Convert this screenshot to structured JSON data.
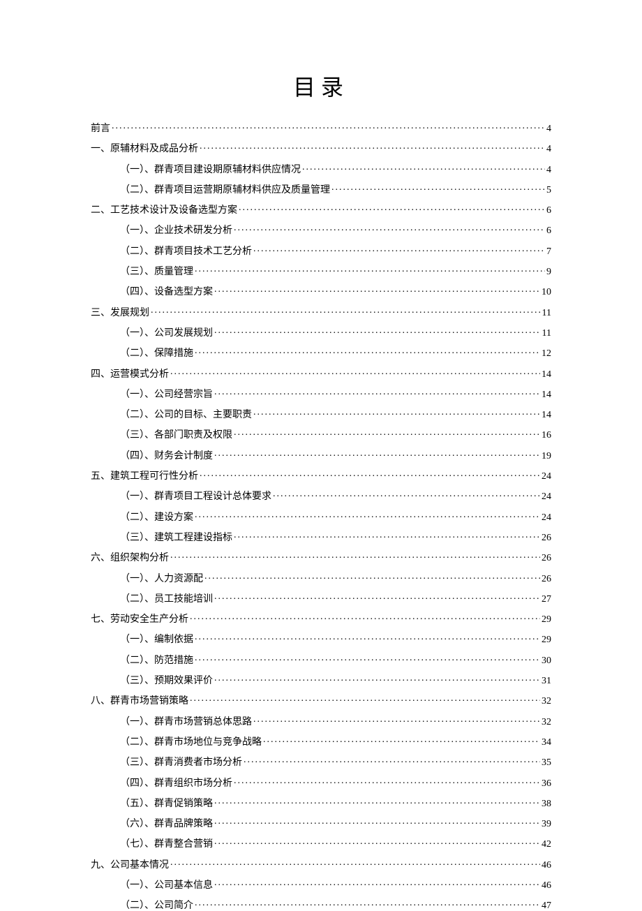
{
  "title": "目录",
  "entries": [
    {
      "level": 1,
      "label": "前言",
      "page": "4"
    },
    {
      "level": 1,
      "label": "一、原辅材料及成品分析",
      "page": "4"
    },
    {
      "level": 2,
      "label": "（一）、群青项目建设期原辅材料供应情况",
      "page": "4"
    },
    {
      "level": 2,
      "label": "（二）、群青项目运营期原辅材料供应及质量管理",
      "page": "5"
    },
    {
      "level": 1,
      "label": "二、工艺技术设计及设备选型方案",
      "page": "6"
    },
    {
      "level": 2,
      "label": "（一）、企业技术研发分析",
      "page": "6"
    },
    {
      "level": 2,
      "label": "（二）、群青项目技术工艺分析",
      "page": "7"
    },
    {
      "level": 2,
      "label": "（三）、质量管理",
      "page": "9"
    },
    {
      "level": 2,
      "label": "（四）、设备选型方案",
      "page": "10"
    },
    {
      "level": 1,
      "label": "三、发展规划",
      "page": "11"
    },
    {
      "level": 2,
      "label": "（一）、公司发展规划",
      "page": "11"
    },
    {
      "level": 2,
      "label": "（二）、保障措施",
      "page": "12"
    },
    {
      "level": 1,
      "label": "四、运营模式分析",
      "page": "14"
    },
    {
      "level": 2,
      "label": "（一）、公司经营宗旨",
      "page": "14"
    },
    {
      "level": 2,
      "label": "（二）、公司的目标、主要职责",
      "page": "14"
    },
    {
      "level": 2,
      "label": "（三）、各部门职责及权限",
      "page": "16"
    },
    {
      "level": 2,
      "label": "（四）、财务会计制度",
      "page": "19"
    },
    {
      "level": 1,
      "label": "五、建筑工程可行性分析",
      "page": "24"
    },
    {
      "level": 2,
      "label": "（一）、群青项目工程设计总体要求",
      "page": "24"
    },
    {
      "level": 2,
      "label": "（二）、建设方案",
      "page": "24"
    },
    {
      "level": 2,
      "label": "（三）、建筑工程建设指标",
      "page": "26"
    },
    {
      "level": 1,
      "label": "六、组织架构分析",
      "page": "26"
    },
    {
      "level": 2,
      "label": "（一）、人力资源配",
      "page": "26"
    },
    {
      "level": 2,
      "label": "（二）、员工技能培训",
      "page": "27"
    },
    {
      "level": 1,
      "label": "七、劳动安全生产分析",
      "page": "29"
    },
    {
      "level": 2,
      "label": "（一）、编制依据",
      "page": "29"
    },
    {
      "level": 2,
      "label": "（二）、防范措施",
      "page": "30"
    },
    {
      "level": 2,
      "label": "（三）、预期效果评价",
      "page": "31"
    },
    {
      "level": 1,
      "label": "八、群青市场营销策略",
      "page": "32"
    },
    {
      "level": 2,
      "label": "（一）、群青市场营销总体思路",
      "page": "32"
    },
    {
      "level": 2,
      "label": "（二）、群青市场地位与竞争战略",
      "page": "34"
    },
    {
      "level": 2,
      "label": "（三）、群青消费者市场分析",
      "page": "35"
    },
    {
      "level": 2,
      "label": "（四）、群青组织市场分析",
      "page": "36"
    },
    {
      "level": 2,
      "label": "（五）、群青促销策略",
      "page": "38"
    },
    {
      "level": 2,
      "label": "（六）、群青品牌策略",
      "page": "39"
    },
    {
      "level": 2,
      "label": "（七）、群青整合营销",
      "page": "42"
    },
    {
      "level": 1,
      "label": "九、公司基本情况",
      "page": "46"
    },
    {
      "level": 2,
      "label": "（一）、公司基本信息",
      "page": "46"
    },
    {
      "level": 2,
      "label": "（二）、公司简介",
      "page": "47"
    }
  ]
}
